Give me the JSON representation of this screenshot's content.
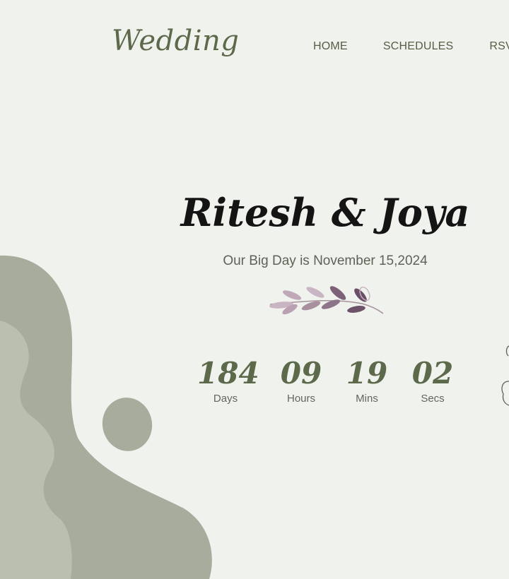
{
  "site": {
    "logo": "Wedding",
    "colors": {
      "background": "#f0f2ed",
      "accent": "#5c6a4b",
      "blob_dark": "#a8ac9d",
      "blob_light": "#bbbfb0",
      "text_dark": "#141414"
    }
  },
  "nav": {
    "items": [
      {
        "label": "HOME"
      },
      {
        "label": "SCHEDULES"
      },
      {
        "label": "RSVP"
      }
    ]
  },
  "hero": {
    "couple": "Ritesh & Joya",
    "subtitle": "Our Big Day is November 15,2024",
    "ornament": "leaf-sprig-icon"
  },
  "countdown": {
    "days": {
      "value": "184",
      "label": "Days"
    },
    "hours": {
      "value": "09",
      "label": "Hours"
    },
    "mins": {
      "value": "19",
      "label": "Mins"
    },
    "secs": {
      "value": "02",
      "label": "Secs"
    }
  }
}
